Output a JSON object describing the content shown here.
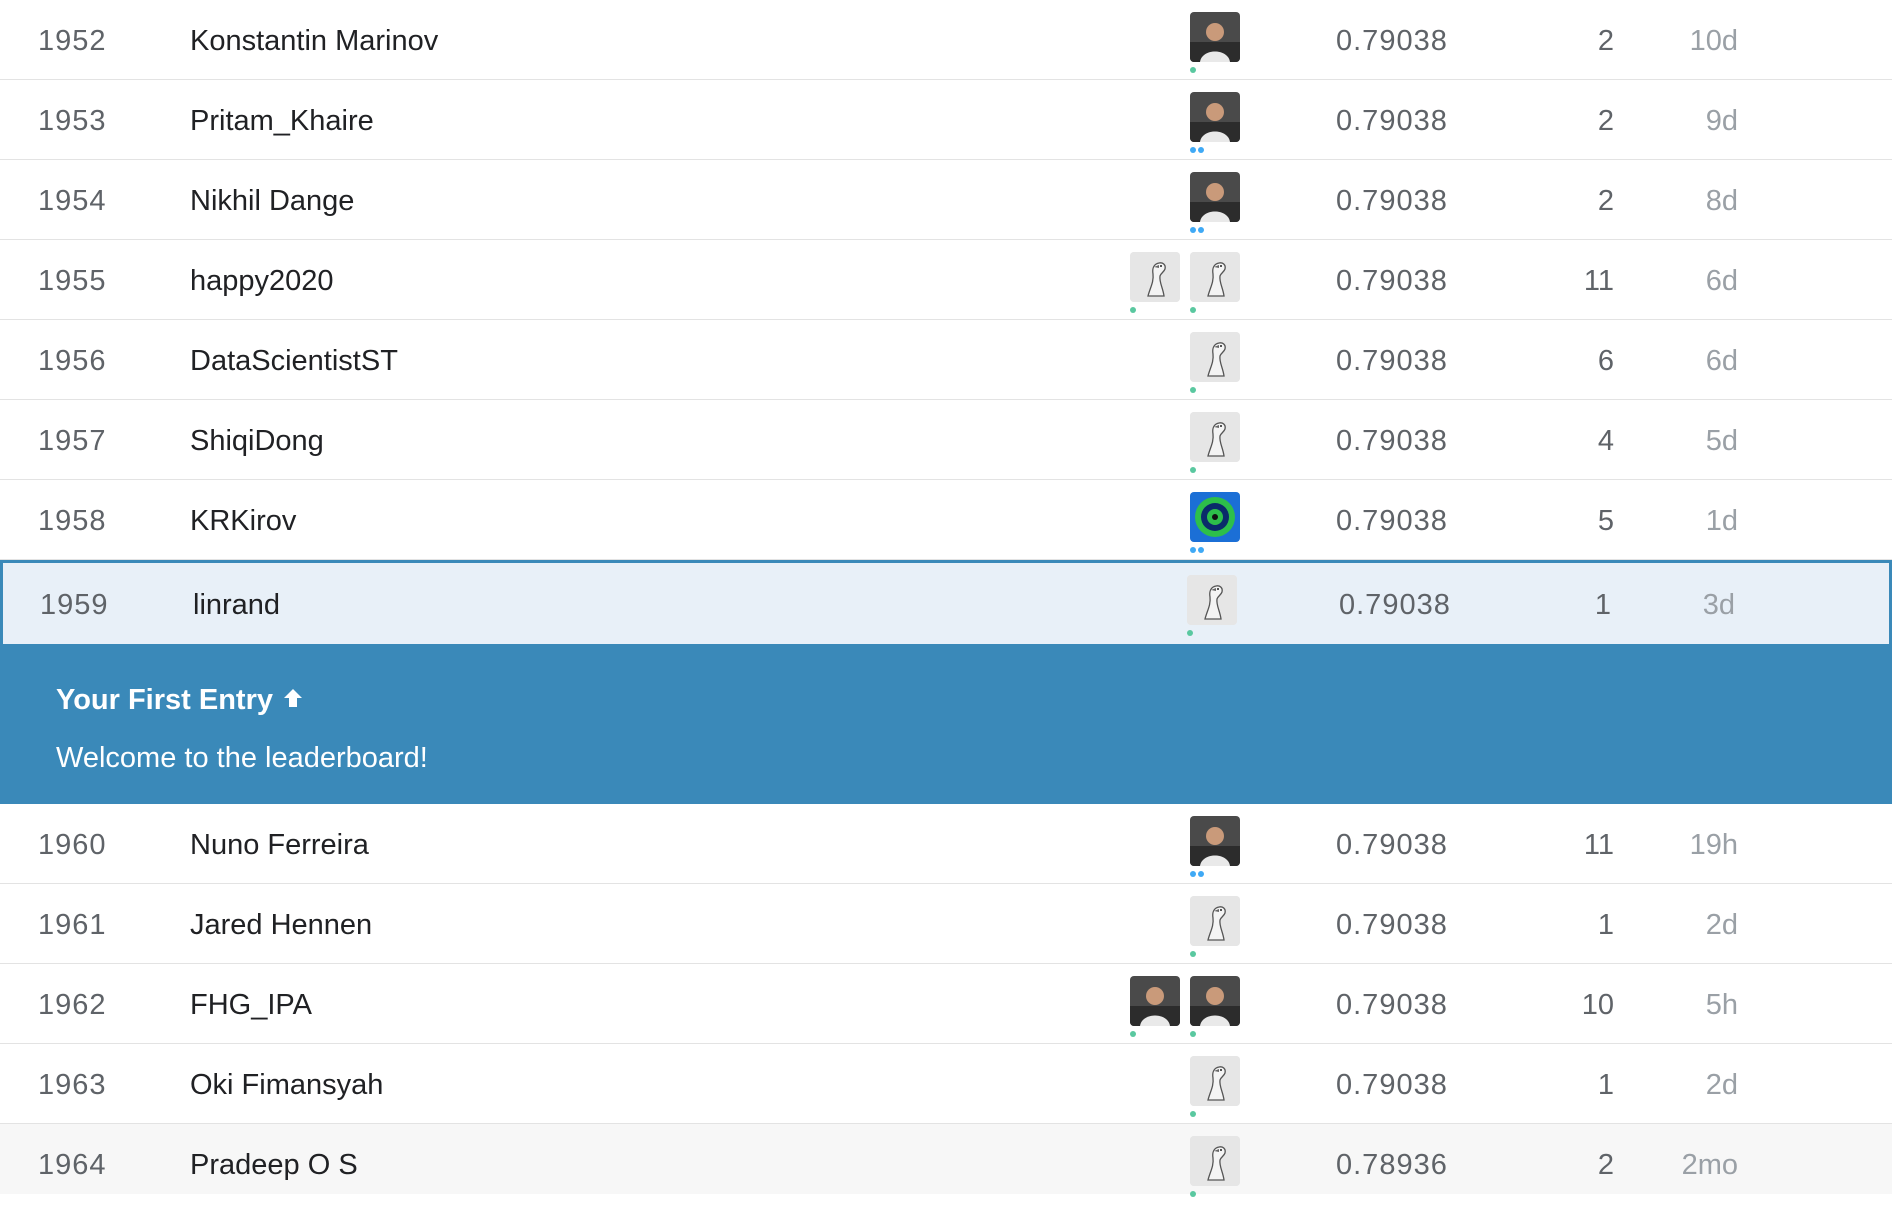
{
  "rows_before": [
    {
      "rank": "1952",
      "name": "Konstantin Marinov",
      "score": "0.79038",
      "entries": "2",
      "last": "10d",
      "avatars": [
        {
          "icon": "person-photo-icon",
          "tier": "novice"
        }
      ]
    },
    {
      "rank": "1953",
      "name": "Pritam_Khaire",
      "score": "0.79038",
      "entries": "2",
      "last": "9d",
      "avatars": [
        {
          "icon": "person-photo-icon",
          "tier": "contrib"
        }
      ]
    },
    {
      "rank": "1954",
      "name": "Nikhil Dange",
      "score": "0.79038",
      "entries": "2",
      "last": "8d",
      "avatars": [
        {
          "icon": "person-photo-icon",
          "tier": "contrib"
        }
      ]
    },
    {
      "rank": "1955",
      "name": "happy2020",
      "score": "0.79038",
      "entries": "11",
      "last": "6d",
      "avatars": [
        {
          "icon": "goose-default-icon",
          "tier": "novice"
        },
        {
          "icon": "goose-default-icon",
          "tier": "novice"
        }
      ]
    },
    {
      "rank": "1956",
      "name": "DataScientistST",
      "score": "0.79038",
      "entries": "6",
      "last": "6d",
      "avatars": [
        {
          "icon": "goose-default-icon",
          "tier": "novice"
        }
      ]
    },
    {
      "rank": "1957",
      "name": "ShiqiDong",
      "score": "0.79038",
      "entries": "4",
      "last": "5d",
      "avatars": [
        {
          "icon": "goose-default-icon",
          "tier": "novice"
        }
      ]
    },
    {
      "rank": "1958",
      "name": "KRKirov",
      "score": "0.79038",
      "entries": "5",
      "last": "1d",
      "avatars": [
        {
          "icon": "pattern-avatar-icon",
          "tier": "contrib"
        }
      ]
    }
  ],
  "my_row": {
    "rank": "1959",
    "name": "linrand",
    "score": "0.79038",
    "entries": "1",
    "last": "3d",
    "avatars": [
      {
        "icon": "goose-default-icon",
        "tier": "novice"
      }
    ]
  },
  "banner": {
    "title": "Your First Entry",
    "arrow_icon": "arrow-up-icon",
    "message": "Welcome to the leaderboard!"
  },
  "rows_after": [
    {
      "rank": "1960",
      "name": "Nuno Ferreira",
      "score": "0.79038",
      "entries": "11",
      "last": "19h",
      "avatars": [
        {
          "icon": "person-photo-icon",
          "tier": "contrib"
        }
      ]
    },
    {
      "rank": "1961",
      "name": "Jared Hennen",
      "score": "0.79038",
      "entries": "1",
      "last": "2d",
      "avatars": [
        {
          "icon": "goose-default-icon",
          "tier": "novice"
        }
      ]
    },
    {
      "rank": "1962",
      "name": "FHG_IPA",
      "score": "0.79038",
      "entries": "10",
      "last": "5h",
      "avatars": [
        {
          "icon": "person-photo-icon",
          "tier": "novice"
        },
        {
          "icon": "person-photo-icon",
          "tier": "novice"
        }
      ]
    },
    {
      "rank": "1963",
      "name": "Oki Fimansyah",
      "score": "0.79038",
      "entries": "1",
      "last": "2d",
      "avatars": [
        {
          "icon": "goose-default-icon",
          "tier": "novice"
        }
      ]
    },
    {
      "rank": "1964",
      "name": "Pradeep O S",
      "score": "0.78936",
      "entries": "2",
      "last": "2mo",
      "avatars": [
        {
          "icon": "goose-default-icon",
          "tier": "novice"
        }
      ]
    }
  ],
  "colors": {
    "highlight_bg": "#e8f0f8",
    "banner_bg": "#3a89b9",
    "novice_dot": "#5ac8a0",
    "contributor_dot": "#3fa9f5"
  }
}
